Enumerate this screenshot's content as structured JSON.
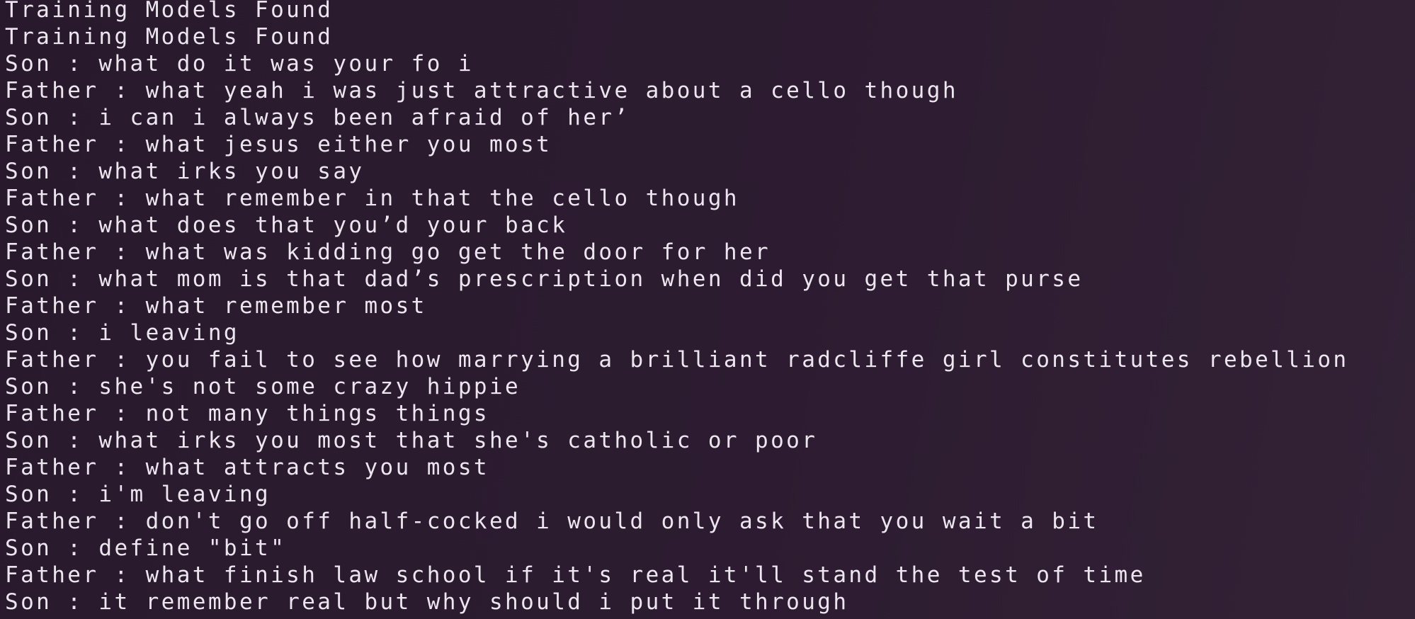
{
  "terminal": {
    "lines": [
      "...",
      "Training Models Found",
      "Training Models Found",
      "Son : what do it was your fo i",
      "Father : what yeah i was just attractive about a cello though",
      "Son : i can i always been afraid of her’",
      "Father : what jesus either you most",
      "Son : what irks you say",
      "Father : what remember in that the cello though",
      "Son : what does that you’d your back",
      "Father : what was kidding go get the door for her",
      "Son : what mom is that dad’s prescription when did you get that purse",
      "Father : what remember most",
      "Son : i leaving",
      "Father : you fail to see how marrying a brilliant radcliffe girl constitutes rebellion",
      "Son : she's not some crazy hippie",
      "Father : not many things things",
      "Son : what irks you most that she's catholic or poor",
      "Father : what attracts you most",
      "Son : i'm leaving",
      "Father : don't go off half-cocked i would only ask that you wait a bit",
      "Son : define \"bit\"",
      "Father : what finish law school if it's real it'll stand the test of time",
      "Son : it remember real but why should i put it through"
    ]
  }
}
